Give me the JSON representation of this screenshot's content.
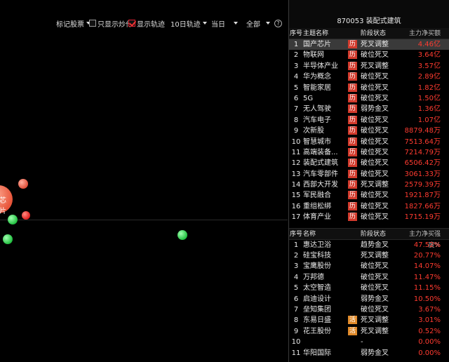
{
  "toolbar": {
    "mark_stocks": "标记股票",
    "only_show_speculation": "只显示炒作",
    "show_track": "显示轨迹",
    "track_days": "10日轨迹",
    "period": "当日",
    "scope": "全部",
    "help": "?"
  },
  "colors": {
    "up": "#ff3b30",
    "down": "#2bd44a",
    "tag_red": "#d23a2c",
    "tag_orange": "#e08a2a"
  },
  "chart": {
    "bubble_label_partial": "芯片"
  },
  "panel": {
    "title": "870053  装配式建筑",
    "top_headers": {
      "no": "序号",
      "name": "主题名称",
      "stage": "阶段状态",
      "value": "主力净买额"
    },
    "top_rows": [
      {
        "no": "1",
        "name": "国产芯片",
        "tag": "历",
        "stage": "死叉调整",
        "value": "4.46亿"
      },
      {
        "no": "2",
        "name": "物联网",
        "tag": "历",
        "stage": "破位死叉",
        "value": "3.64亿"
      },
      {
        "no": "3",
        "name": "半导体产业",
        "tag": "历",
        "stage": "死叉调整",
        "value": "3.57亿"
      },
      {
        "no": "4",
        "name": "华为概念",
        "tag": "历",
        "stage": "破位死叉",
        "value": "2.89亿"
      },
      {
        "no": "5",
        "name": "智能家居",
        "tag": "历",
        "stage": "破位死叉",
        "value": "1.82亿"
      },
      {
        "no": "6",
        "name": "5G",
        "tag": "历",
        "stage": "破位死叉",
        "value": "1.50亿"
      },
      {
        "no": "7",
        "name": "无人驾驶",
        "tag": "历",
        "stage": "弱势金叉",
        "value": "1.36亿"
      },
      {
        "no": "8",
        "name": "汽车电子",
        "tag": "历",
        "stage": "破位死叉",
        "value": "1.07亿"
      },
      {
        "no": "9",
        "name": "次新股",
        "tag": "历",
        "stage": "破位死叉",
        "value": "8879.48万"
      },
      {
        "no": "10",
        "name": "智慧城市",
        "tag": "历",
        "stage": "破位死叉",
        "value": "7513.64万"
      },
      {
        "no": "11",
        "name": "高端装备...",
        "tag": "历",
        "stage": "破位死叉",
        "value": "7214.79万"
      },
      {
        "no": "12",
        "name": "装配式建筑",
        "tag": "历",
        "stage": "破位死叉",
        "value": "6506.42万"
      },
      {
        "no": "13",
        "name": "汽车零部件",
        "tag": "历",
        "stage": "破位死叉",
        "value": "3061.33万"
      },
      {
        "no": "14",
        "name": "西部大开发",
        "tag": "历",
        "stage": "死叉调整",
        "value": "2579.39万"
      },
      {
        "no": "15",
        "name": "军民融合",
        "tag": "历",
        "stage": "破位死叉",
        "value": "1921.87万"
      },
      {
        "no": "16",
        "name": "重组松绑",
        "tag": "历",
        "stage": "破位死叉",
        "value": "1827.66万"
      },
      {
        "no": "17",
        "name": "体育产业",
        "tag": "历",
        "stage": "破位死叉",
        "value": "1715.19万"
      }
    ],
    "bottom_headers": {
      "no": "序号",
      "name": "名称",
      "stage": "阶段状态",
      "value": "主力净买强度%"
    },
    "bottom_rows": [
      {
        "no": "1",
        "name": "惠达卫浴",
        "tag": "",
        "stage": "趋势金叉",
        "value": "47.52%"
      },
      {
        "no": "2",
        "name": "硅宝科技",
        "tag": "",
        "stage": "死叉调整",
        "value": "20.77%"
      },
      {
        "no": "3",
        "name": "宝鹰股份",
        "tag": "",
        "stage": "破位死叉",
        "value": "14.07%"
      },
      {
        "no": "4",
        "name": "万邦德",
        "tag": "",
        "stage": "破位死叉",
        "value": "11.47%"
      },
      {
        "no": "5",
        "name": "太空智造",
        "tag": "",
        "stage": "破位死叉",
        "value": "11.15%"
      },
      {
        "no": "6",
        "name": "启迪设计",
        "tag": "",
        "stage": "弱势金叉",
        "value": "10.50%"
      },
      {
        "no": "7",
        "name": "垒知集团",
        "tag": "",
        "stage": "破位死叉",
        "value": "3.67%"
      },
      {
        "no": "8",
        "name": "东易日盛",
        "tag": "活",
        "stage": "死叉调整",
        "value": "3.01%"
      },
      {
        "no": "9",
        "name": "花王股份",
        "tag": "活",
        "stage": "死叉调整",
        "value": "0.52%"
      },
      {
        "no": "10",
        "name": "",
        "tag": "",
        "stage": "-",
        "value": "0.00%"
      },
      {
        "no": "11",
        "name": "华阳国际",
        "tag": "",
        "stage": "弱势金叉",
        "value": "0.00%"
      }
    ]
  }
}
